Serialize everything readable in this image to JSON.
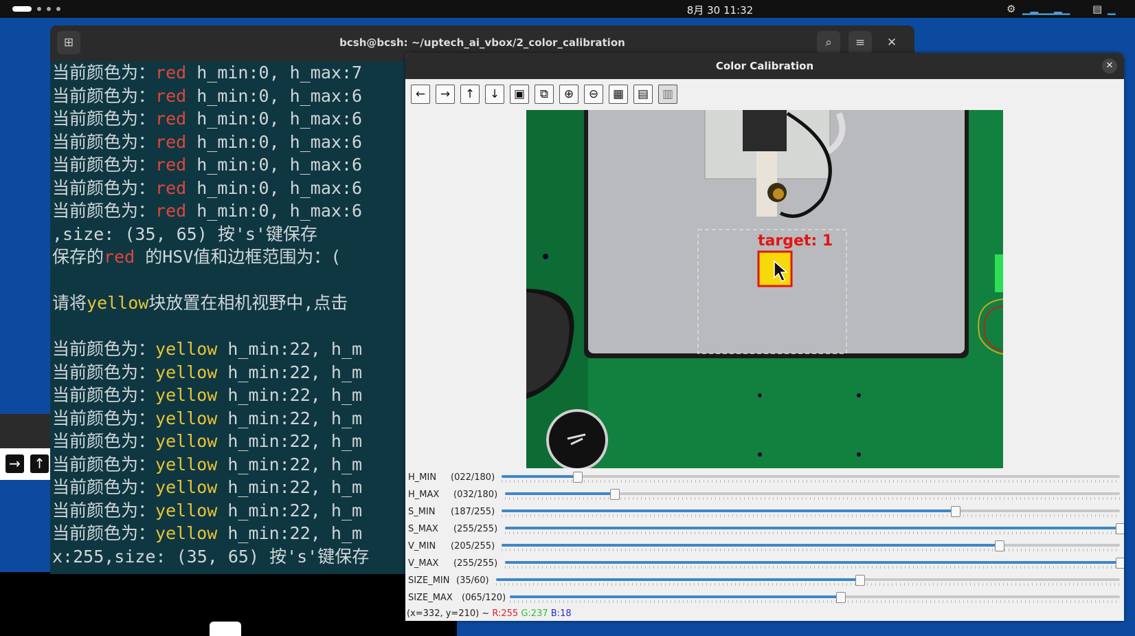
{
  "topbar": {
    "clock": "8月 30 11:32",
    "tray_icons": [
      "cpu-icon",
      "network-icon",
      "memory-icon"
    ]
  },
  "terminal": {
    "title": "bcsh@bcsh: ~/uptech_ai_vbox/2_color_calibration",
    "lines": [
      {
        "pre": "当前颜色为：",
        "color": "red",
        "post": " h_min:0, h_max:7"
      },
      {
        "pre": "当前颜色为：",
        "color": "red",
        "post": " h_min:0, h_max:6"
      },
      {
        "pre": "当前颜色为：",
        "color": "red",
        "post": " h_min:0, h_max:6"
      },
      {
        "pre": "当前颜色为：",
        "color": "red",
        "post": " h_min:0, h_max:6"
      },
      {
        "pre": "当前颜色为：",
        "color": "red",
        "post": " h_min:0, h_max:6"
      },
      {
        "pre": "当前颜色为：",
        "color": "red",
        "post": " h_min:0, h_max:6"
      },
      {
        "pre": "当前颜色为：",
        "color": "red",
        "post": " h_min:0, h_max:6"
      },
      {
        "pre": ",size: (35, 65) 按's'键保存",
        "color": "",
        "post": ""
      },
      {
        "pre": "保存的",
        "color": "red",
        "post": " 的HSV值和边框范围为：("
      },
      {
        "pre": "",
        "color": "",
        "post": ""
      },
      {
        "pre": "请将",
        "color": "yellow",
        "post": "块放置在相机视野中,点击"
      },
      {
        "pre": "",
        "color": "",
        "post": ""
      },
      {
        "pre": "当前颜色为：",
        "color": "yellow",
        "post": " h_min:22, h_m"
      },
      {
        "pre": "当前颜色为：",
        "color": "yellow",
        "post": " h_min:22, h_m"
      },
      {
        "pre": "当前颜色为：",
        "color": "yellow",
        "post": " h_min:22, h_m"
      },
      {
        "pre": "当前颜色为：",
        "color": "yellow",
        "post": " h_min:22, h_m"
      },
      {
        "pre": "当前颜色为：",
        "color": "yellow",
        "post": " h_min:22, h_m"
      },
      {
        "pre": "当前颜色为：",
        "color": "yellow",
        "post": " h_min:22, h_m"
      },
      {
        "pre": "当前颜色为：",
        "color": "yellow",
        "post": " h_min:22, h_m"
      },
      {
        "pre": "当前颜色为：",
        "color": "yellow",
        "post": " h_min:22, h_m"
      },
      {
        "pre": "当前颜色为：",
        "color": "yellow",
        "post": " h_min:22, h_m"
      },
      {
        "pre": "x:255,size: (35, 65) 按's'键保存",
        "color": "",
        "post": ""
      }
    ]
  },
  "calib": {
    "title": "Color Calibration",
    "toolbar": [
      "arrow-left-icon",
      "arrow-right-icon",
      "arrow-up-icon",
      "arrow-down-icon",
      "image-icon",
      "image-zoom-icon",
      "zoom-in-icon",
      "zoom-out-icon",
      "save-icon",
      "clipboard-icon",
      "properties-icon"
    ],
    "overlay_label": "target: 1",
    "sliders": [
      {
        "name": "H_MIN",
        "value": "(022/180)",
        "frac": 0.122
      },
      {
        "name": "H_MAX",
        "value": "(032/180)",
        "frac": 0.178
      },
      {
        "name": "S_MIN",
        "value": "(187/255)",
        "frac": 0.733
      },
      {
        "name": "S_MAX",
        "value": "(255/255)",
        "frac": 1.0
      },
      {
        "name": "V_MIN",
        "value": "(205/255)",
        "frac": 0.804
      },
      {
        "name": "V_MAX",
        "value": "(255/255)",
        "frac": 1.0
      },
      {
        "name": "SIZE_MIN",
        "value": "(35/60)",
        "frac": 0.583
      },
      {
        "name": "SIZE_MAX",
        "value": "(065/120)",
        "frac": 0.542
      }
    ],
    "status": {
      "coords": "(x=332, y=210) ~ ",
      "r": "R:255",
      "g": "G:237",
      "b": "B:18"
    }
  }
}
